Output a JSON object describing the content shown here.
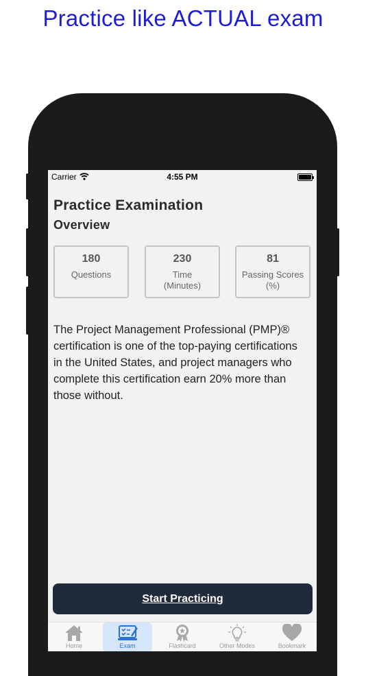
{
  "promo": {
    "title": "Practice like ACTUAL exam"
  },
  "status_bar": {
    "carrier": "Carrier",
    "time": "4:55 PM"
  },
  "screen": {
    "title": "Practice Examination",
    "subtitle": "Overview",
    "stats": [
      {
        "value": "180",
        "label": "Questions"
      },
      {
        "value": "230",
        "label": "Time (Minutes)"
      },
      {
        "value": "81",
        "label": "Passing Scores (%)"
      }
    ],
    "description": "The Project Management Professional (PMP)® certification is one of the top-paying certifications in the United States, and project managers who complete this certification earn 20% more than those without.",
    "start_button": "Start Practicing"
  },
  "tab_bar": {
    "items": [
      {
        "label": "Home",
        "icon": "home-icon"
      },
      {
        "label": "Exam",
        "icon": "exam-icon",
        "active": true
      },
      {
        "label": "Flashcard",
        "icon": "award-badge-icon"
      },
      {
        "label": "Other Modes",
        "icon": "lightbulb-icon"
      },
      {
        "label": "Bookmark",
        "icon": "heart-icon"
      }
    ]
  },
  "colors": {
    "promo_title": "#1d1dd6",
    "phone_frame": "#1b1b1b",
    "button_background": "#1f2a3a",
    "tab_active": "#2e72c9",
    "tab_active_background": "#d5e6fb"
  }
}
